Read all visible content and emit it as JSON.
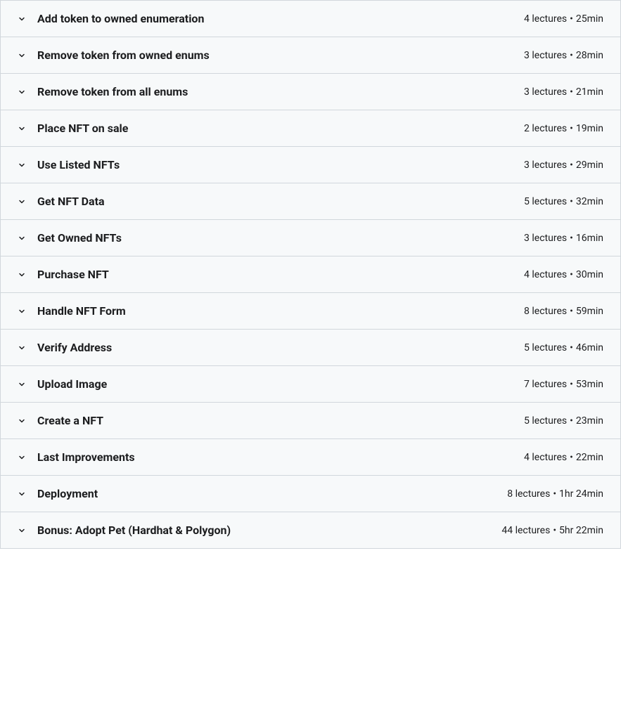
{
  "sections": [
    {
      "title": "Add token to owned enumeration",
      "lectures": "4 lectures",
      "duration": "25min"
    },
    {
      "title": "Remove token from owned enums",
      "lectures": "3 lectures",
      "duration": "28min"
    },
    {
      "title": "Remove token from all enums",
      "lectures": "3 lectures",
      "duration": "21min"
    },
    {
      "title": "Place NFT on sale",
      "lectures": "2 lectures",
      "duration": "19min"
    },
    {
      "title": "Use Listed NFTs",
      "lectures": "3 lectures",
      "duration": "29min"
    },
    {
      "title": "Get NFT Data",
      "lectures": "5 lectures",
      "duration": "32min"
    },
    {
      "title": "Get Owned NFTs",
      "lectures": "3 lectures",
      "duration": "16min"
    },
    {
      "title": "Purchase NFT",
      "lectures": "4 lectures",
      "duration": "30min"
    },
    {
      "title": "Handle NFT Form",
      "lectures": "8 lectures",
      "duration": "59min"
    },
    {
      "title": "Verify Address",
      "lectures": "5 lectures",
      "duration": "46min"
    },
    {
      "title": "Upload Image",
      "lectures": "7 lectures",
      "duration": "53min"
    },
    {
      "title": "Create a NFT",
      "lectures": "5 lectures",
      "duration": "23min"
    },
    {
      "title": "Last Improvements",
      "lectures": "4 lectures",
      "duration": "22min"
    },
    {
      "title": "Deployment",
      "lectures": "8 lectures",
      "duration": "1hr 24min"
    },
    {
      "title": "Bonus: Adopt Pet (Hardhat & Polygon)",
      "lectures": "44 lectures",
      "duration": "5hr 22min"
    }
  ],
  "separator": "•"
}
